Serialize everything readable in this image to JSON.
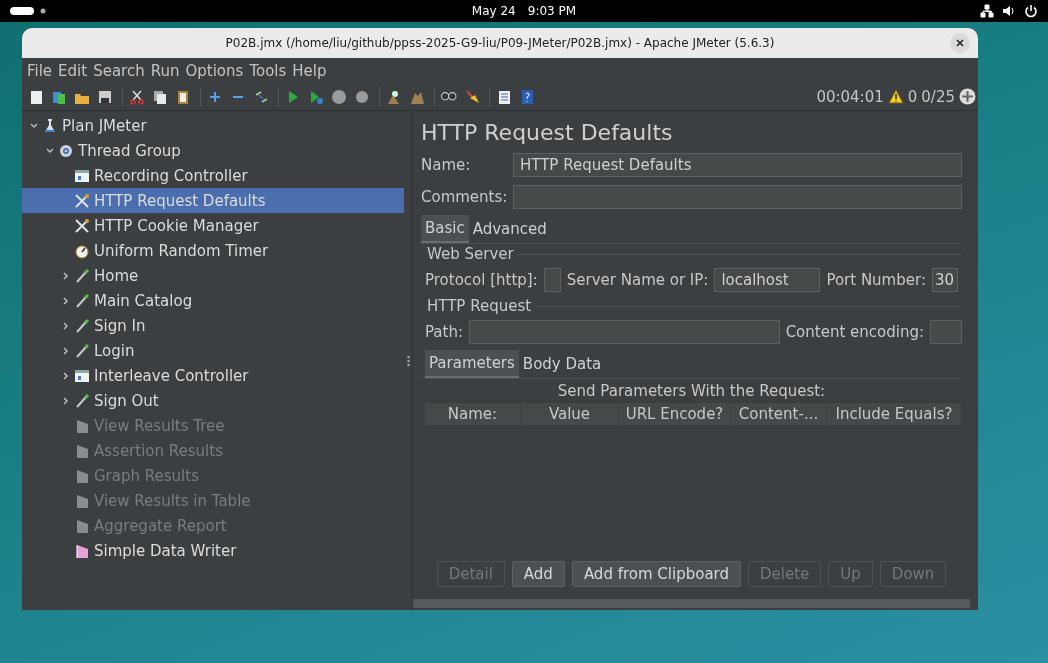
{
  "system_bar": {
    "date": "May 24",
    "time": "9:03 PM"
  },
  "window": {
    "title": "P02B.jmx (/home/liu/github/ppss-2025-G9-liu/P09-JMeter/P02B.jmx) - Apache JMeter (5.6.3)"
  },
  "menu": [
    "File",
    "Edit",
    "Search",
    "Run",
    "Options",
    "Tools",
    "Help"
  ],
  "status": {
    "elapsed": "00:04:01",
    "warnings": "0",
    "threads": "0/25"
  },
  "tree": [
    {
      "label": "Plan JMeter",
      "kind": "plan",
      "expanded": true,
      "selected": false,
      "disabled": false,
      "children": [
        {
          "label": "Thread Group",
          "kind": "threads",
          "expanded": true,
          "selected": false,
          "disabled": false,
          "children": [
            {
              "label": "Recording Controller",
              "kind": "controller",
              "selected": false,
              "disabled": false
            },
            {
              "label": "HTTP Request Defaults",
              "kind": "config",
              "selected": true,
              "disabled": false
            },
            {
              "label": "HTTP Cookie Manager",
              "kind": "config",
              "selected": false,
              "disabled": false
            },
            {
              "label": "Uniform Random Timer",
              "kind": "timer",
              "selected": false,
              "disabled": false
            },
            {
              "label": "Home",
              "kind": "sampler",
              "expanded": false,
              "selected": false,
              "disabled": false
            },
            {
              "label": "Main Catalog",
              "kind": "sampler",
              "expanded": false,
              "selected": false,
              "disabled": false
            },
            {
              "label": "Sign In",
              "kind": "sampler",
              "expanded": false,
              "selected": false,
              "disabled": false
            },
            {
              "label": "Login",
              "kind": "sampler",
              "expanded": false,
              "selected": false,
              "disabled": false
            },
            {
              "label": "Interleave Controller",
              "kind": "controller",
              "expanded": false,
              "selected": false,
              "disabled": false
            },
            {
              "label": "Sign Out",
              "kind": "sampler",
              "expanded": false,
              "selected": false,
              "disabled": false
            },
            {
              "label": "View Results Tree",
              "kind": "listener",
              "selected": false,
              "disabled": true
            },
            {
              "label": "Assertion Results",
              "kind": "listener",
              "selected": false,
              "disabled": true
            },
            {
              "label": "Graph Results",
              "kind": "listener",
              "selected": false,
              "disabled": true
            },
            {
              "label": "View Results in Table",
              "kind": "listener",
              "selected": false,
              "disabled": true
            },
            {
              "label": "Aggregate Report",
              "kind": "listener",
              "selected": false,
              "disabled": true
            },
            {
              "label": "Simple Data Writer",
              "kind": "writer",
              "selected": false,
              "disabled": false
            }
          ]
        }
      ]
    }
  ],
  "editor": {
    "title": "HTTP Request Defaults",
    "name_label": "Name:",
    "name_value": "HTTP Request Defaults",
    "comments_label": "Comments:",
    "tabs": [
      {
        "label": "Basic",
        "selected": true
      },
      {
        "label": "Advanced",
        "selected": false
      }
    ],
    "web_server": {
      "legend": "Web Server",
      "protocol_label": "Protocol [http]:",
      "server_label": "Server Name or IP:",
      "server_value": "localhost",
      "port_label": "Port Number:",
      "port_value": "30"
    },
    "http_request": {
      "legend": "HTTP Request",
      "path_label": "Path:",
      "encoding_label": "Content encoding:"
    },
    "param_tabs": [
      {
        "label": "Parameters",
        "selected": true
      },
      {
        "label": "Body Data",
        "selected": false
      }
    ],
    "params_title": "Send Parameters With the Request:",
    "columns": [
      "Name:",
      "Value",
      "URL Encode?",
      "Content-...",
      "Include Equals?"
    ],
    "buttons": [
      {
        "label": "Detail",
        "disabled": true
      },
      {
        "label": "Add",
        "disabled": false
      },
      {
        "label": "Add from Clipboard",
        "disabled": false
      },
      {
        "label": "Delete",
        "disabled": true
      },
      {
        "label": "Up",
        "disabled": true
      },
      {
        "label": "Down",
        "disabled": true
      }
    ]
  }
}
